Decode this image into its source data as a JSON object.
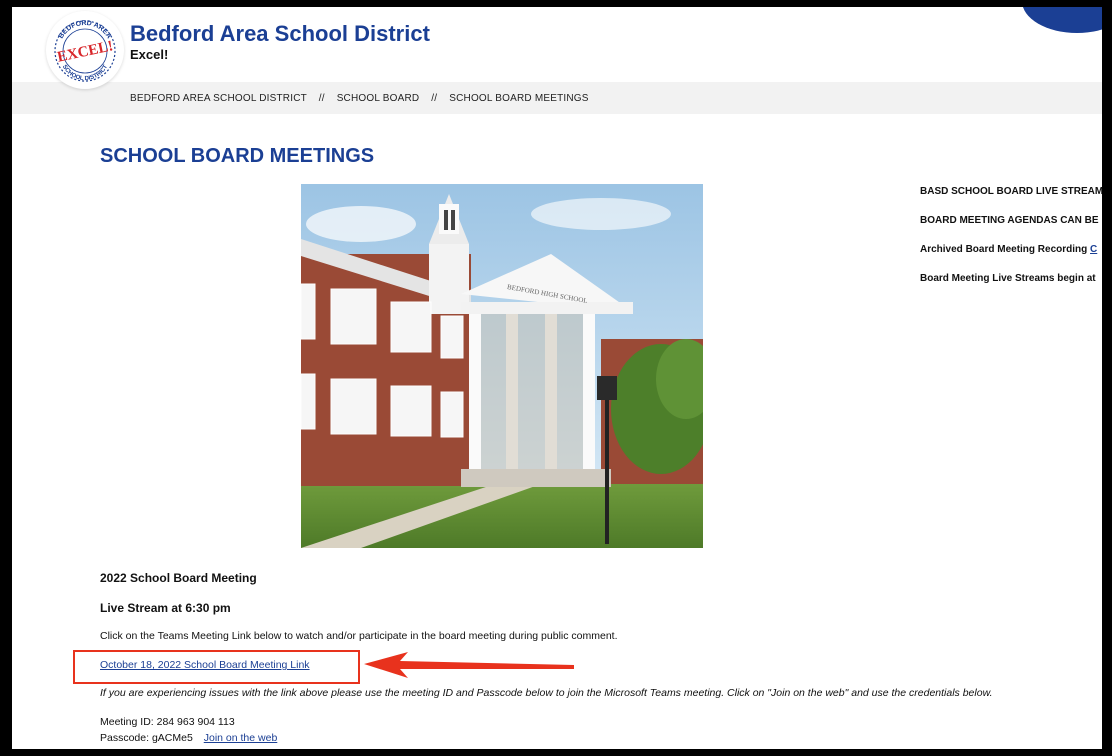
{
  "header": {
    "site_title": "Bedford Area School District",
    "tagline": "Excel!",
    "logo": {
      "top_text": "BEDFORD AREA",
      "center_text": "EXCEL!",
      "bottom_text": "SCHOOL DISTRICT"
    }
  },
  "breadcrumb": {
    "items": [
      "BEDFORD AREA SCHOOL DISTRICT",
      "SCHOOL BOARD",
      "SCHOOL BOARD MEETINGS"
    ],
    "separator": "//"
  },
  "main": {
    "title": "SCHOOL BOARD MEETINGS",
    "photo_sign": "BEDFORD HIGH SCHOOL",
    "meeting_heading": "2022 School Board Meeting",
    "stream_heading": "Live Stream at 6:30 pm",
    "instructions": "Click on the Teams Meeting Link below to watch and/or participate in the board meeting during public comment.",
    "meeting_link": "October 18, 2022 School Board Meeting Link",
    "note": "If you are experiencing issues with the link above please use the meeting ID and Passcode below to join the Microsoft Teams meeting.  Click on \"Join on the web\" and use the credentials below.",
    "meeting_id": "Meeting ID: 284 963 904 113",
    "passcode": "Passcode: gACMe5",
    "join_web": "Join on the web"
  },
  "side_notes": {
    "live_stream": "BASD SCHOOL BOARD LIVE STREAM",
    "agendas": "BOARD MEETING AGENDAS CAN BE",
    "archived_label": "Archived Board Meeting Recording",
    "archived_link": "C",
    "live_begin": "Board Meeting Live Streams begin at"
  },
  "colors": {
    "brand_blue": "#1b3f94",
    "annotation_red": "#e8321d",
    "breadcrumb_bg": "#f2f2f2"
  }
}
